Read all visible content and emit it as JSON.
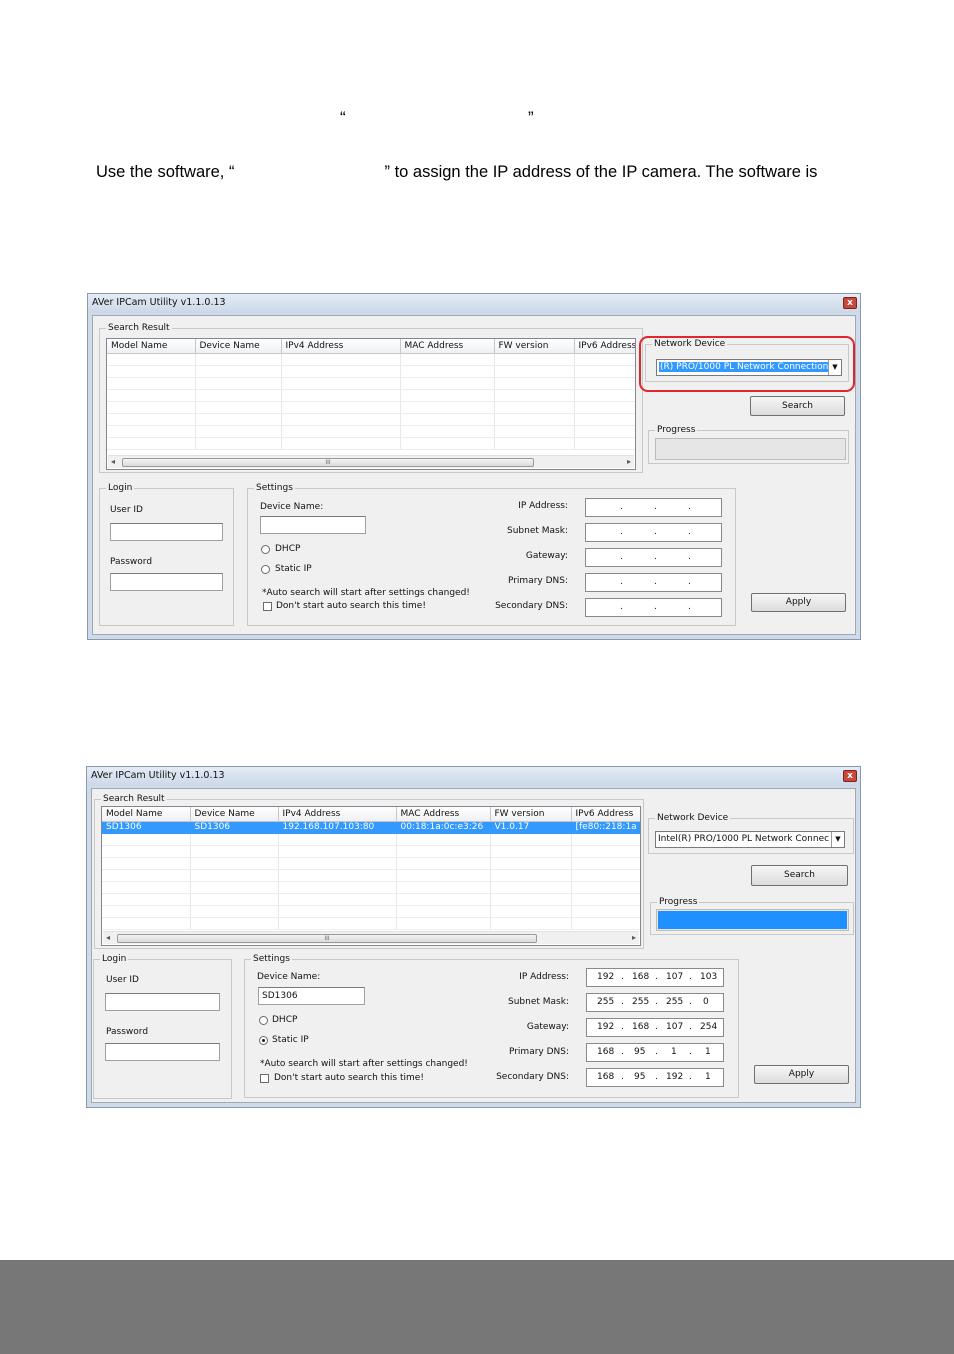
{
  "page": {
    "open_quote": "“",
    "close_quote": "”",
    "intro_left": "Use the software, “",
    "intro_right": "” to assign the IP address of the IP camera. The software is"
  },
  "window1": {
    "title": "AVer IPCam Utility v1.1.0.13",
    "close_label": "x",
    "search_result_label": "Search Result",
    "columns": [
      "Model Name",
      "Device Name",
      "IPv4 Address",
      "MAC Address",
      "FW version",
      "IPv6 Address"
    ],
    "scroll_thumb": "III",
    "network_device_label": "Network Device",
    "network_device_value": "(R) PRO/1000 PL Network Connection",
    "search_button": "Search",
    "progress_label": "Progress",
    "progress": 0,
    "login_label": "Login",
    "user_id_label": "User ID",
    "password_label": "Password",
    "settings_label": "Settings",
    "device_name_label": "Device Name:",
    "device_name_value": "",
    "dhcp_label": "DHCP",
    "static_ip_label": "Static IP",
    "auto_note": "*Auto search will start after settings changed!",
    "dont_start_label": "Don't start auto search this time!",
    "ip_address_label": "IP Address:",
    "subnet_mask_label": "Subnet Mask:",
    "gateway_label": "Gateway:",
    "primary_dns_label": "Primary DNS:",
    "secondary_dns_label": "Secondary DNS:",
    "dot": ".",
    "apply_button": "Apply"
  },
  "window2": {
    "title": "AVer IPCam Utility v1.1.0.13",
    "close_label": "x",
    "search_result_label": "Search Result",
    "columns": [
      "Model Name",
      "Device Name",
      "IPv4 Address",
      "MAC Address",
      "FW version",
      "IPv6 Address"
    ],
    "row": [
      "SD1306",
      "SD1306",
      "192.168.107.103:80",
      "00:18:1a:0c:e3:26",
      "V1.0.17",
      "[fe80::218:1a"
    ],
    "scroll_thumb": "III",
    "network_device_label": "Network Device",
    "network_device_value": "Intel(R) PRO/1000 PL Network Connec",
    "search_button": "Search",
    "progress_label": "Progress",
    "progress": 1,
    "login_label": "Login",
    "user_id_label": "User ID",
    "password_label": "Password",
    "settings_label": "Settings",
    "device_name_label": "Device Name:",
    "device_name_value": "SD1306",
    "dhcp_label": "DHCP",
    "static_ip_label": "Static IP",
    "auto_note": "*Auto search will start after settings changed!",
    "dont_start_label": "Don't start auto search this time!",
    "ip_address_label": "IP Address:",
    "subnet_mask_label": "Subnet Mask:",
    "gateway_label": "Gateway:",
    "primary_dns_label": "Primary DNS:",
    "secondary_dns_label": "Secondary DNS:",
    "ip_address": [
      "192",
      "168",
      "107",
      "103"
    ],
    "subnet_mask": [
      "255",
      "255",
      "255",
      "0"
    ],
    "gateway": [
      "192",
      "168",
      "107",
      "254"
    ],
    "primary_dns": [
      "168",
      "95",
      "1",
      "1"
    ],
    "secondary_dns": [
      "168",
      "95",
      "192",
      "1"
    ],
    "dot": ".",
    "apply_button": "Apply"
  },
  "colors": {
    "highlight": "#e0262b",
    "selection": "#3399ff",
    "footer": "#777777"
  }
}
